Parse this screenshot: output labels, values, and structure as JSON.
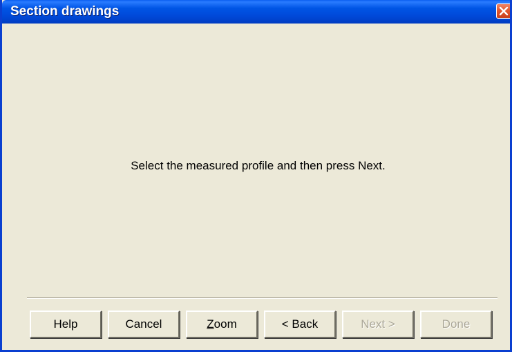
{
  "window": {
    "title": "Section drawings"
  },
  "main": {
    "message": "Select the measured profile and then press Next."
  },
  "buttons": {
    "help": "Help",
    "cancel": "Cancel",
    "zoom_mnemonic": "Z",
    "zoom_rest": "oom",
    "back": "< Back",
    "next": "Next >",
    "done": "Done"
  },
  "colors": {
    "titlebar": "#0055e5",
    "dialog_bg": "#ece9d8",
    "close_button": "#e2572f",
    "disabled_text": "#aca899"
  },
  "icons": {
    "close": "close-icon"
  }
}
